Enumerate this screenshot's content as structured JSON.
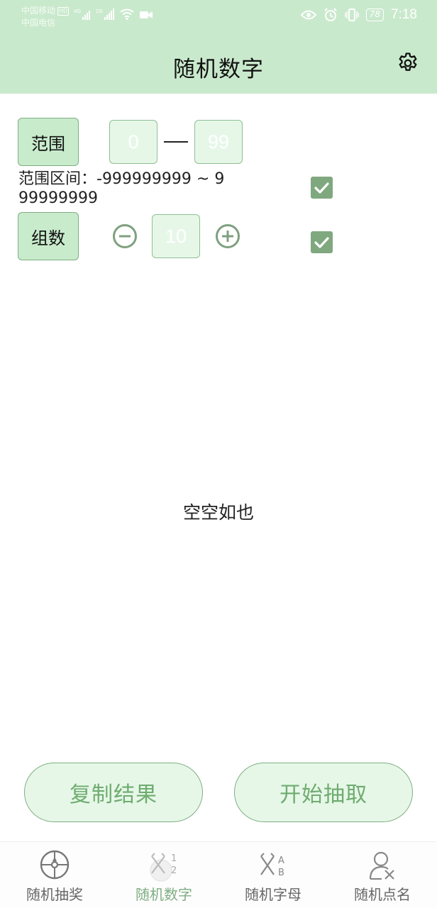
{
  "status_bar": {
    "carrier_1": "中国移动",
    "carrier_1_badge": "HD",
    "carrier_2": "中国电信",
    "signal_1_label": "4G",
    "signal_2_label": "2G",
    "battery": "78",
    "time": "7:18"
  },
  "app_bar": {
    "title": "随机数字",
    "settings_icon": "gear-icon"
  },
  "controls": {
    "range_label": "范围",
    "range_min": "0",
    "range_max": "99",
    "range_info": "范围区间：-999999999 ~ 999999999",
    "range_checkbox_checked": true,
    "group_label": "组数",
    "group_count": "10",
    "group_checkbox_checked": true
  },
  "results": {
    "empty_text": "空空如也"
  },
  "actions": {
    "copy_label": "复制结果",
    "start_label": "开始抽取"
  },
  "bottom_nav": {
    "items": [
      {
        "label": "随机抽奖",
        "icon": "wheel-icon",
        "active": false
      },
      {
        "label": "随机数字",
        "icon": "random-number-icon",
        "active": true
      },
      {
        "label": "随机字母",
        "icon": "random-letter-icon",
        "active": false
      },
      {
        "label": "随机点名",
        "icon": "random-person-icon",
        "active": false
      }
    ]
  },
  "colors": {
    "header_bg": "#c9e9cc",
    "accent": "#7fae83",
    "button_fill": "#e6f7e8",
    "accent_text": "#6fac6f"
  }
}
